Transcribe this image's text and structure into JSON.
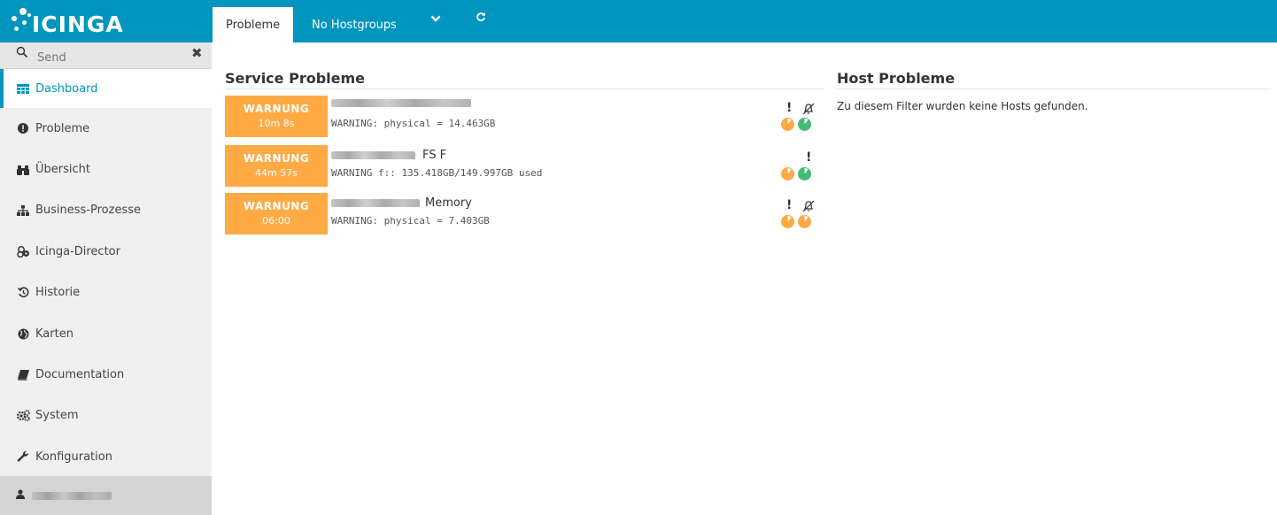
{
  "app": {
    "logo_text": "icinga",
    "accent_color": "#0095bf",
    "warning_color": "#ffaa44",
    "ok_color": "#44bb77"
  },
  "search": {
    "placeholder": "Send",
    "icon": "search-icon",
    "close_icon": "close-icon"
  },
  "sidebar": {
    "items": [
      {
        "label": "Dashboard",
        "icon": "grid-icon",
        "active": true
      },
      {
        "label": "Probleme",
        "icon": "alert-circle-icon",
        "active": false
      },
      {
        "label": "Übersicht",
        "icon": "binoculars-icon",
        "active": false
      },
      {
        "label": "Business-Prozesse",
        "icon": "sitemap-icon",
        "active": false
      },
      {
        "label": "Icinga-Director",
        "icon": "cogs-group-icon",
        "active": false
      },
      {
        "label": "Historie",
        "icon": "history-icon",
        "active": false
      },
      {
        "label": "Karten",
        "icon": "globe-icon",
        "active": false
      },
      {
        "label": "Documentation",
        "icon": "book-icon",
        "active": false
      },
      {
        "label": "System",
        "icon": "gears-icon",
        "active": false
      },
      {
        "label": "Konfiguration",
        "icon": "wrench-icon",
        "active": false
      }
    ],
    "user_icon": "user-icon"
  },
  "topbar": {
    "tabs": [
      {
        "label": "Probleme",
        "active": true
      },
      {
        "label": "No Hostgroups",
        "active": false
      }
    ],
    "dropdown_icon": "chevron-down-icon",
    "refresh_icon": "refresh-icon"
  },
  "service_problems": {
    "title": "Service Probleme",
    "rows": [
      {
        "state": "WARNUNG",
        "duration": "10m 8s",
        "title_suffix": "",
        "output": "WARNING: physical = 14.463GB",
        "flags": [
          "acknowledged",
          "notifications-disabled"
        ],
        "pies": [
          "warning",
          "ok"
        ]
      },
      {
        "state": "WARNUNG",
        "duration": "44m 57s",
        "title_suffix": "FS F",
        "output": "WARNING f:: 135.418GB/149.997GB used",
        "flags": [
          "acknowledged"
        ],
        "pies": [
          "warning",
          "ok"
        ]
      },
      {
        "state": "WARNUNG",
        "duration": "06:00",
        "title_suffix": "Memory",
        "output": "WARNING: physical = 7.403GB",
        "flags": [
          "acknowledged",
          "notifications-disabled"
        ],
        "pies": [
          "warning",
          "warning"
        ]
      }
    ]
  },
  "host_problems": {
    "title": "Host Probleme",
    "empty_message": "Zu diesem Filter wurden keine Hosts gefunden."
  }
}
